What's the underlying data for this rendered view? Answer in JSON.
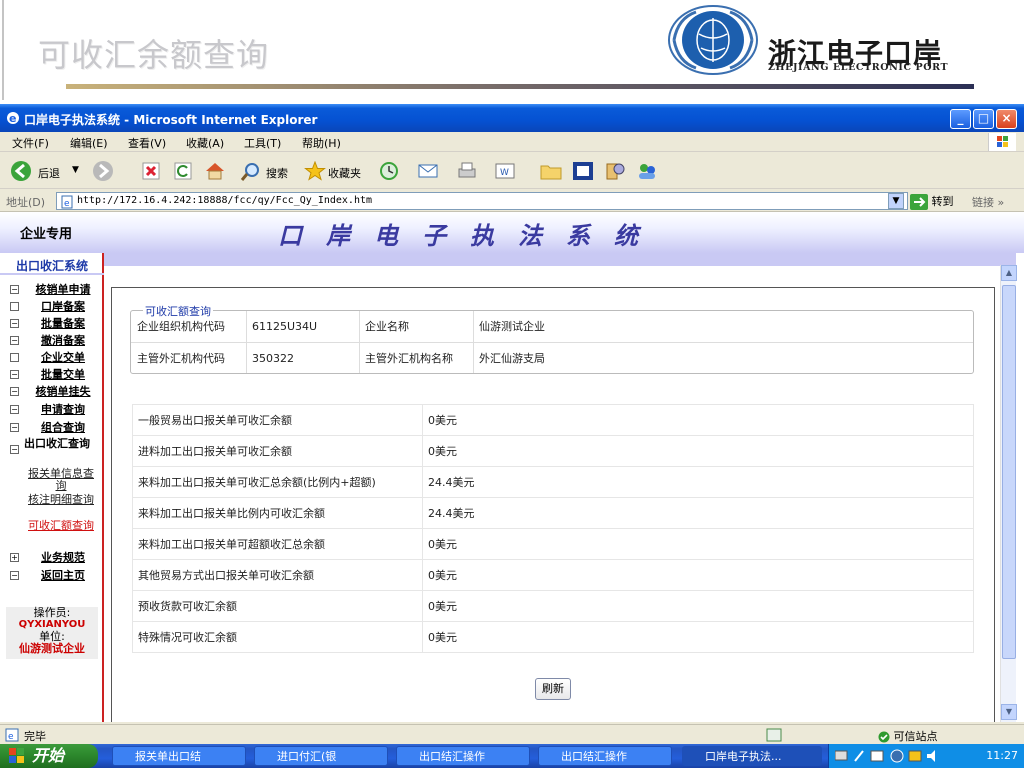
{
  "slide": {
    "title": "可收汇余额查询",
    "logo_cn": "浙江电子口岸",
    "logo_en": "ZHEJIANG ELECTRONIC PORT"
  },
  "window": {
    "title": "口岸电子执法系统 - Microsoft Internet Explorer"
  },
  "menu": [
    "文件(F)",
    "编辑(E)",
    "查看(V)",
    "收藏(A)",
    "工具(T)",
    "帮助(H)"
  ],
  "toolbar": {
    "back_label": "后退",
    "search_label": "搜索",
    "favorites_label": "收藏夹"
  },
  "address": {
    "label": "地址(D)",
    "url": "http://172.16.4.242:18888/fcc/qy/Fcc_Qy_Index.htm",
    "go_label": "转到",
    "links_label": "链接"
  },
  "page": {
    "corp_only": "企业专用",
    "system_title": "口岸电子执法系统",
    "sidebar_header": "出口收汇系统",
    "nav": [
      {
        "box": "−",
        "label": "核销单申请"
      },
      {
        "box": "",
        "label": "口岸备案"
      },
      {
        "box": "−",
        "label": "批量备案"
      },
      {
        "box": "−",
        "label": "撤消备案"
      },
      {
        "box": "",
        "label": "企业交单"
      },
      {
        "box": "−",
        "label": "批量交单"
      },
      {
        "box": "−",
        "label": "核销单挂失"
      },
      {
        "box": "−",
        "label": "申请查询"
      },
      {
        "box": "−",
        "label": "组合查询"
      },
      {
        "box": "−",
        "label": "出口收汇查询"
      }
    ],
    "subnav": [
      "报关单信息查询",
      "核注明细查询",
      "可收汇额查询"
    ],
    "nav_after": [
      {
        "box": "+",
        "label": "业务规范"
      },
      {
        "box": "−",
        "label": "返回主页"
      }
    ],
    "operator_label": "操作员:",
    "operator_value": "QYXIANYOU",
    "unit_label": "单位:",
    "unit_value": "仙游测试企业",
    "fieldset_legend": "可收汇额查询",
    "org_code_label": "企业组织机构代码",
    "org_code_value": "61125U34U",
    "company_label": "企业名称",
    "company_value": "仙游测试企业",
    "forex_code_label": "主管外汇机构代码",
    "forex_code_value": "350322",
    "forex_name_label": "主管外汇机构名称",
    "forex_name_value": "外汇仙游支局",
    "amounts": [
      {
        "label": "一般贸易出口报关单可收汇余额",
        "value": "0美元"
      },
      {
        "label": "进料加工出口报关单可收汇余额",
        "value": "0美元"
      },
      {
        "label": "来料加工出口报关单可收汇总余额(比例内+超额)",
        "value": "24.4美元"
      },
      {
        "label": "来料加工出口报关单比例内可收汇余额",
        "value": "24.4美元"
      },
      {
        "label": "来料加工出口报关单可超额收汇总余额",
        "value": "0美元"
      },
      {
        "label": "其他贸易方式出口报关单可收汇余额",
        "value": "0美元"
      },
      {
        "label": "预收货款可收汇余额",
        "value": "0美元"
      },
      {
        "label": "特殊情况可收汇余额",
        "value": "0美元"
      }
    ],
    "refresh_label": "刷新"
  },
  "status": {
    "text": "完毕",
    "zone": "可信站点"
  },
  "taskbar": {
    "start": "开始",
    "items": [
      "报关单出口结",
      "进口付汇(银",
      "出口结汇操作",
      "出口结汇操作",
      "口岸电子执法..."
    ],
    "clock": "11:27"
  }
}
